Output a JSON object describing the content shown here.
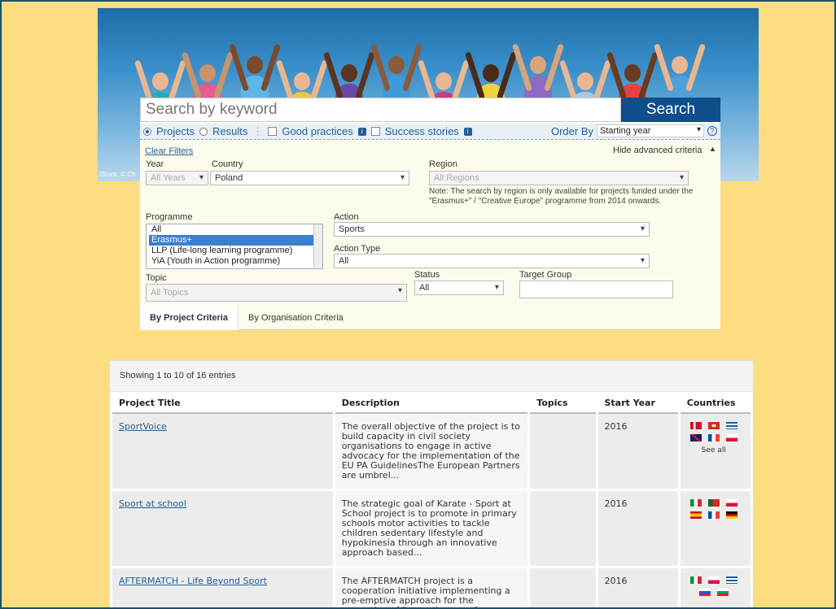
{
  "hero": {
    "credit": "iStock. © Ch"
  },
  "search": {
    "placeholder": "Search by keyword",
    "button": "Search"
  },
  "filters": {
    "type_projects": "Projects",
    "type_results": "Results",
    "good_practices": "Good practices",
    "success_stories": "Success stories",
    "order_by_label": "Order By",
    "order_by_value": "Starting year",
    "clear_filters": "Clear Filters",
    "hide_advanced": "Hide advanced criteria",
    "year_label": "Year",
    "year_value": "All Years",
    "country_label": "Country",
    "country_value": "Poland",
    "region_label": "Region",
    "region_value": "All Regions",
    "region_note": "Note: The search by region is only available for projects funded under the \"Erasmus+\" / \"Creative Europe\" programme from 2014 onwards.",
    "programme_label": "Programme",
    "programme_options": [
      "All",
      "Erasmus+",
      "LLP (Life-long learning programme)",
      "YiA (Youth in Action programme)"
    ],
    "programme_selected": "Erasmus+",
    "action_label": "Action",
    "action_value": "Sports",
    "action_type_label": "Action Type",
    "action_type_value": "All",
    "topic_label": "Topic",
    "topic_value": "All Topics",
    "status_label": "Status",
    "status_value": "All",
    "target_group_label": "Target Group",
    "target_group_value": "",
    "tab_project": "By Project Criteria",
    "tab_organisation": "By Organisation Criteria"
  },
  "results": {
    "showing": "Showing 1 to 10 of 16 entries",
    "columns": [
      "Project Title",
      "Description",
      "Topics",
      "Start Year",
      "Countries"
    ],
    "rows": [
      {
        "title": "SportVoice",
        "description": "The overall objective of the project is to build capacity in civil society organisations to engage in active advocacy for the implementation of the EU PA GuidelinesThe European Partners are umbrel...",
        "topics": "",
        "year": "2016",
        "flags": [
          "denmark-flag",
          "switzerland-flag",
          "greece-flag",
          "uk-flag",
          "france-flag",
          "poland-flag"
        ],
        "see_all": "See all"
      },
      {
        "title": "Sport at school",
        "description": "The strategic goal of Karate - Sport at School project is to promote in primary schools motor activities to tackle children sedentary lifestyle and hypokinesia through an innovative approach based...",
        "topics": "",
        "year": "2016",
        "flags": [
          "italy-flag",
          "portugal-flag",
          "poland-flag",
          "spain-flag",
          "france-flag",
          "germany-flag"
        ],
        "see_all": ""
      },
      {
        "title": "AFTERMATCH - Life Beyond Sport",
        "description": "The AFTERMATCH project is a cooperation initiative implementing a pre-emptive approach for the promotion of \"second careers\" among athletes (young and ex)",
        "topics": "",
        "year": "2016",
        "flags": [
          "italy-flag",
          "poland-flag",
          "greece-flag",
          "slovenia-flag",
          "bulgaria-flag"
        ],
        "see_all": ""
      }
    ]
  },
  "colors": {
    "background": "#fedc82",
    "search_button": "#0f4e8a",
    "link": "#1f5f99",
    "selected": "#3b7fd1"
  }
}
